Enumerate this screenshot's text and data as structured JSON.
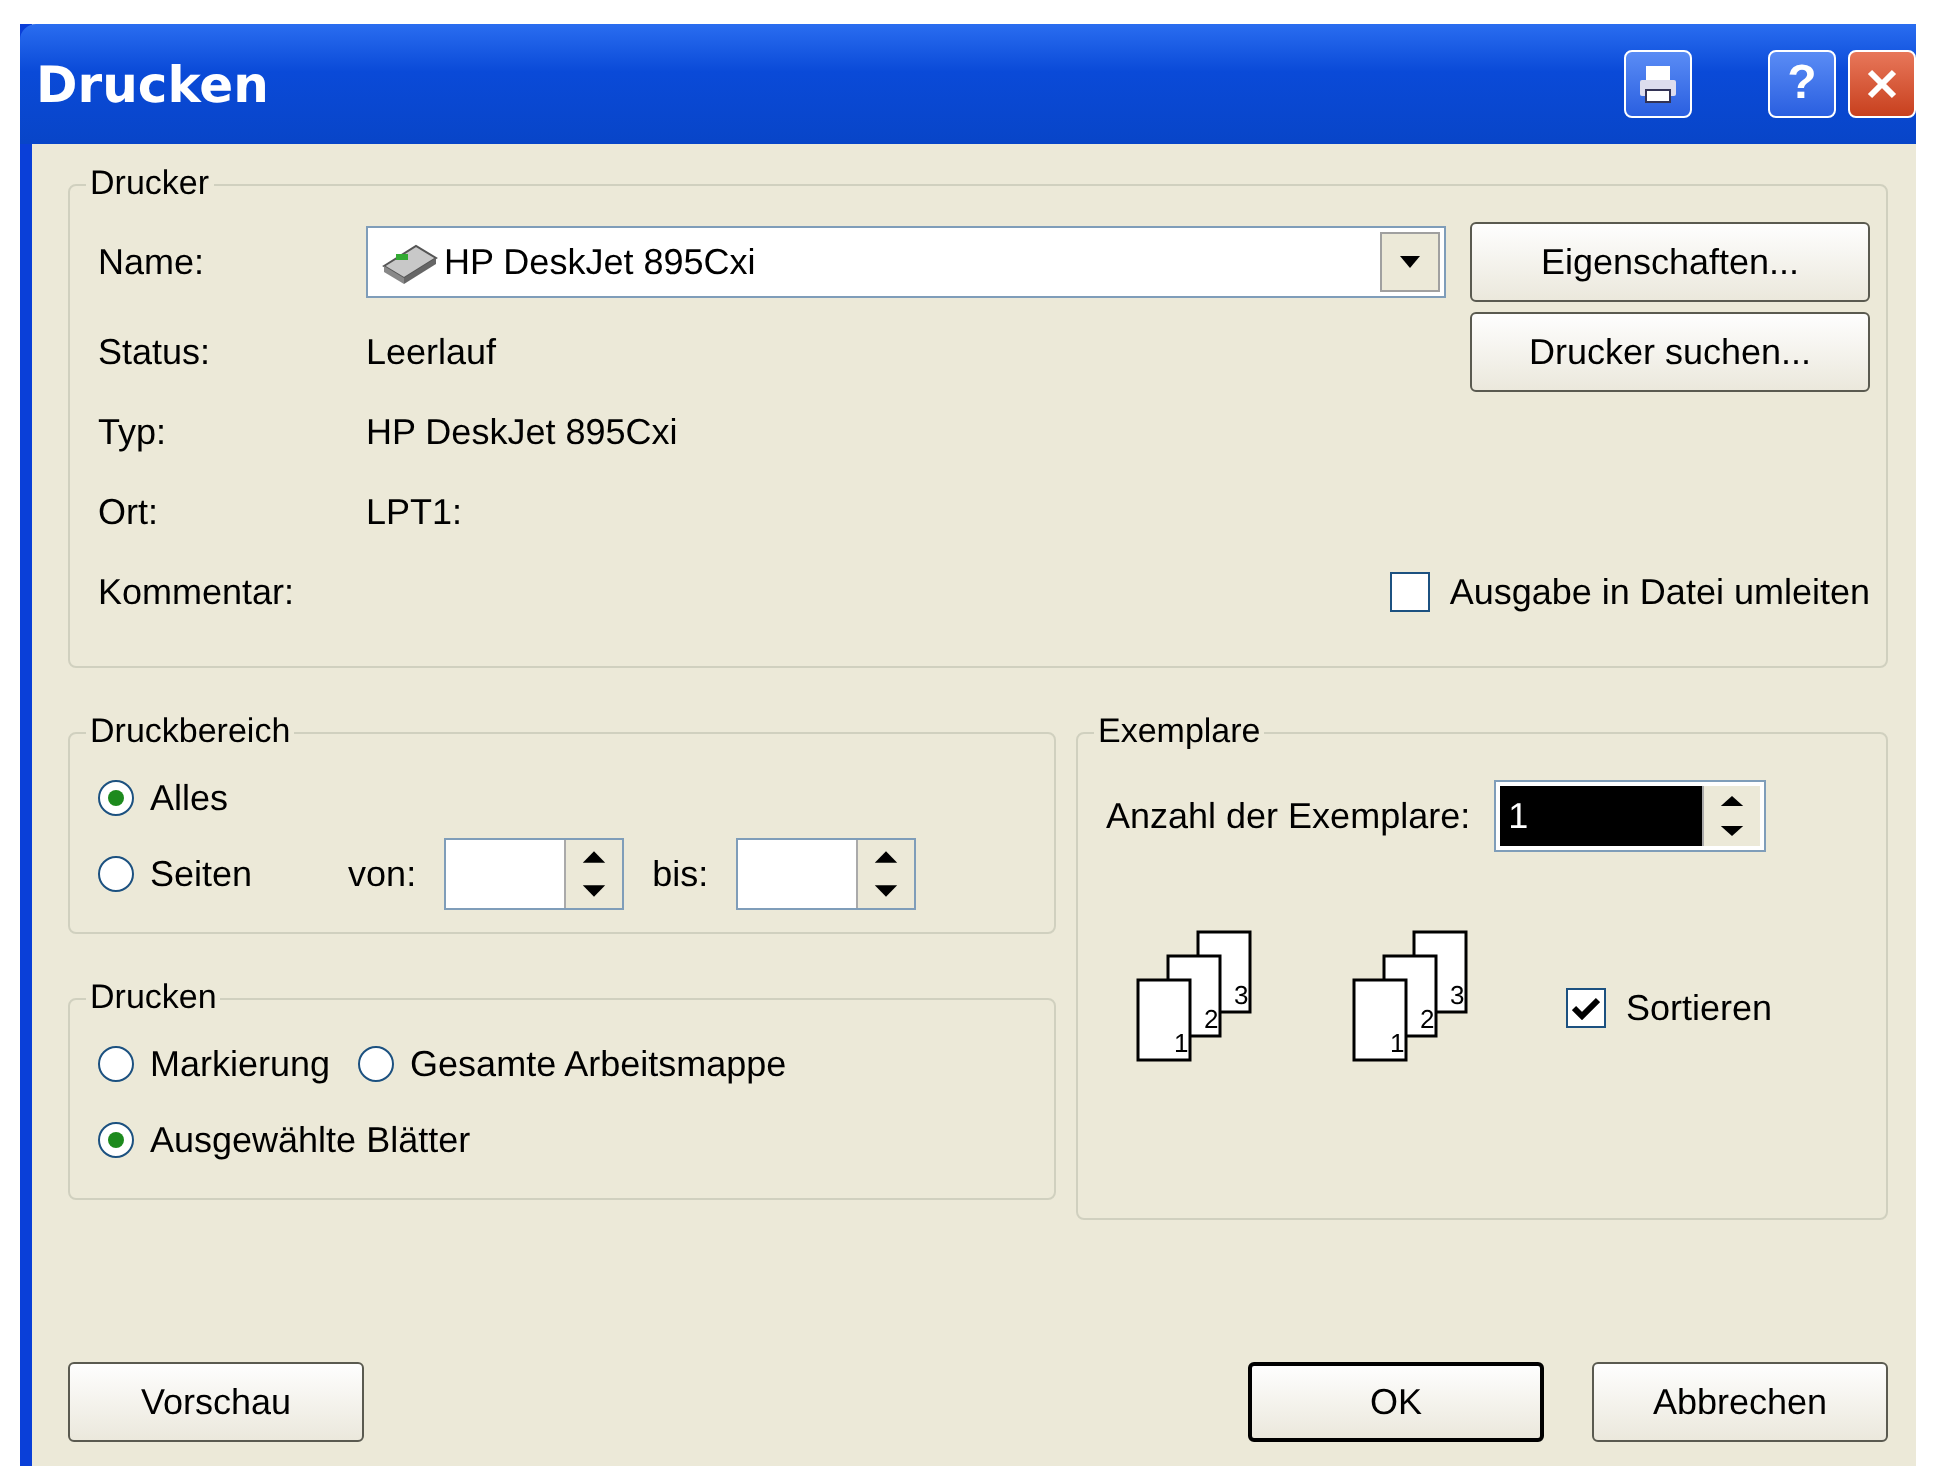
{
  "window": {
    "title": "Drucken"
  },
  "title_buttons": [
    {
      "kind": "printer"
    },
    {
      "kind": "help",
      "label": "?"
    },
    {
      "kind": "close"
    }
  ],
  "printer": {
    "legend": "Drucker",
    "name_label": "Name:",
    "name_value": "HP DeskJet 895Cxi",
    "info": [
      {
        "label": "Status:",
        "value": "Leerlauf"
      },
      {
        "label": "Typ:",
        "value": "HP DeskJet 895Cxi"
      },
      {
        "label": "Ort:",
        "value": "LPT1:"
      },
      {
        "label": "Kommentar:"
      }
    ],
    "buttons": [
      "Eigenschaften...",
      "Drucker suchen..."
    ],
    "print_to_file": {
      "label": "Ausgabe in Datei umleiten",
      "checked": false
    }
  },
  "range": {
    "legend": "Druckbereich",
    "options": [
      {
        "label": "Alles",
        "selected": true
      },
      {
        "label": "Seiten",
        "selected": false
      }
    ],
    "from_label": "von:",
    "to_label": "bis:"
  },
  "print_what": {
    "legend": "Drucken",
    "options": [
      {
        "label": "Markierung",
        "selected": false
      },
      {
        "label": "Gesamte Arbeitsmappe",
        "selected": false
      },
      {
        "label": "Ausgewählte Blätter",
        "selected": true
      }
    ]
  },
  "copies": {
    "legend": "Exemplare",
    "count_label": "Anzahl der Exemplare:",
    "count_value": "1",
    "collate_icons": [
      {
        "pages": [
          "1",
          "2",
          "3"
        ]
      },
      {
        "pages": [
          "1",
          "2",
          "3"
        ]
      }
    ],
    "collate": {
      "label": "Sortieren",
      "checked": true
    }
  },
  "buttons": [
    {
      "label": "Vorschau",
      "default": false
    },
    {
      "label": "OK",
      "default": true
    },
    {
      "label": "Abbrechen",
      "default": false
    }
  ]
}
